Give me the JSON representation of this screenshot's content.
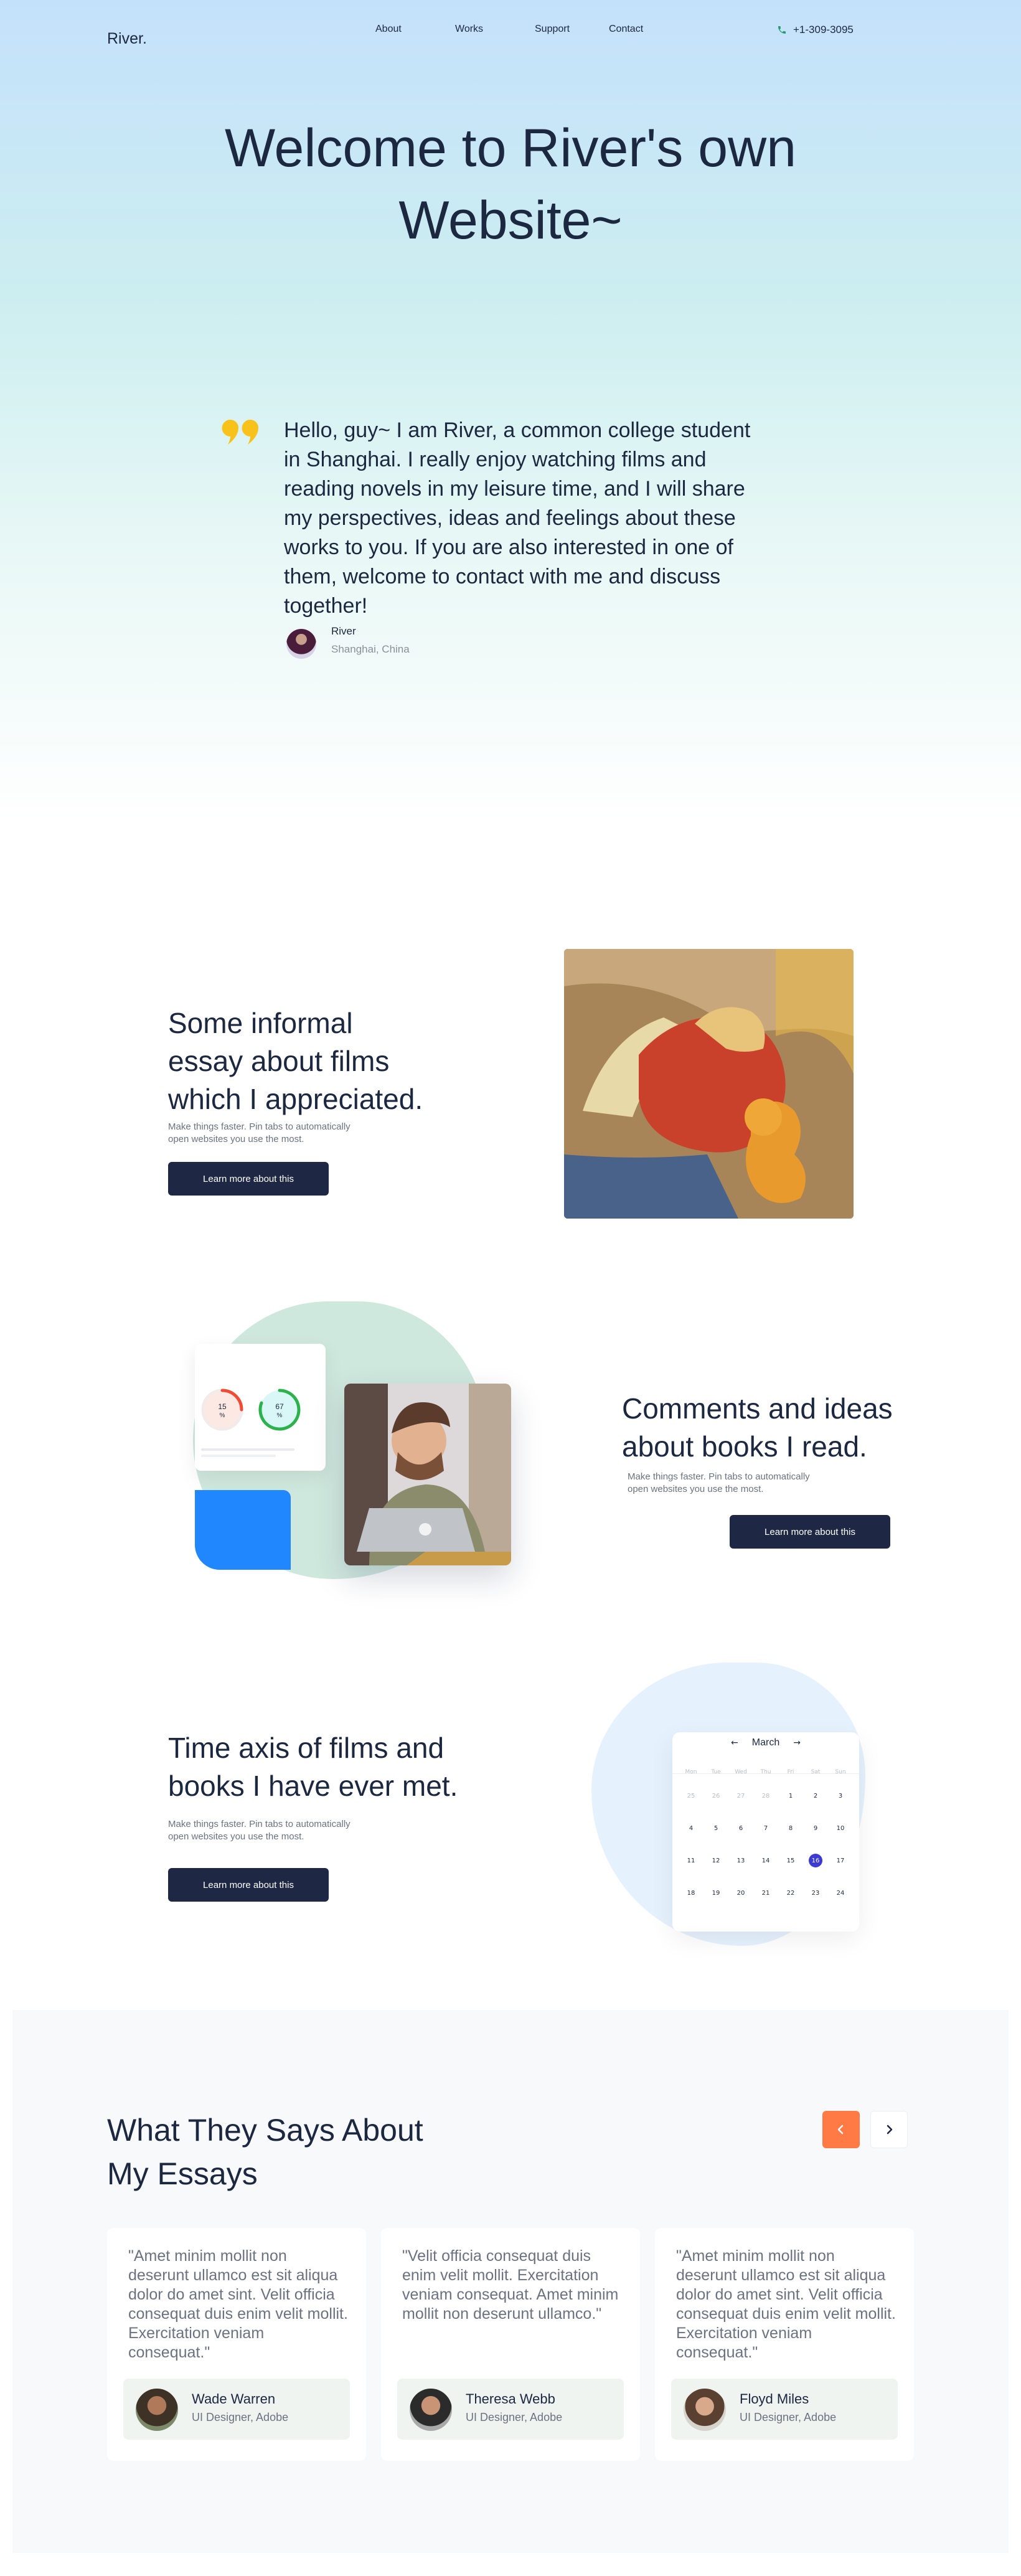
{
  "brand": "River.",
  "nav": {
    "about": "About",
    "works": "Works",
    "support": "Support",
    "contact": "Contact"
  },
  "phone": "+1-309-3095",
  "hero": {
    "title_line1": "Welcome to River's own",
    "title_line2": "Website~",
    "quote": "Hello, guy~ I am River, a common college student in Shanghai. I really enjoy watching films and reading novels in my leisure time, and I will share my perspectives, ideas and feelings about these works to you. If you are also interested in one of them, welcome to contact with me and discuss together!",
    "author_name": "River",
    "author_location": "Shanghai, China"
  },
  "features": [
    {
      "title_line1": "Some informal",
      "title_line2": "essay about films",
      "title_line3": "which I appreciated.",
      "desc_line1": "Make things faster. Pin tabs to automatically",
      "desc_line2": "open websites you use the most.",
      "button": "Learn more about this"
    },
    {
      "title_line1": "Comments and ideas",
      "title_line2": "about books I read.",
      "desc_line1": "Make things faster. Pin tabs to automatically",
      "desc_line2": "open websites you use the most.",
      "button": "Learn more about this"
    },
    {
      "title_line1": "Time axis of films and",
      "title_line2": "books I have ever met.",
      "desc_line1": "Make things faster. Pin tabs to automatically",
      "desc_line2": "open websites you use the most.",
      "button": "Learn more about this"
    }
  ],
  "ring_card": {
    "value1": "15",
    "value2": "67",
    "unit": "%"
  },
  "calendar": {
    "month": "March",
    "weekdays": [
      "Mon",
      "Tue",
      "Wed",
      "Thu",
      "Fri",
      "Sat",
      "Sun"
    ],
    "days": [
      "25",
      "26",
      "27",
      "28",
      "1",
      "2",
      "3",
      "4",
      "5",
      "6",
      "7",
      "8",
      "9",
      "10",
      "11",
      "12",
      "13",
      "14",
      "15",
      "16",
      "17",
      "18",
      "19",
      "20",
      "21",
      "22",
      "23",
      "24"
    ],
    "selected": "16"
  },
  "testimonials": {
    "title_line1": "What They Says About",
    "title_line2": "My Essays",
    "prev_icon": "chevron-left-icon",
    "next_icon": "chevron-right-icon",
    "accent": "#ff7a45",
    "items": [
      {
        "quote": "\"Amet minim mollit non deserunt ullamco est sit aliqua dolor do amet sint. Velit officia consequat duis enim velit mollit. Exercitation veniam consequat.\"",
        "name": "Wade Warren",
        "role": "UI Designer, Adobe"
      },
      {
        "quote": "\"Velit officia consequat duis enim velit mollit. Exercitation veniam consequat. Amet minim mollit non deserunt ullamco.\"",
        "name": "Theresa Webb",
        "role": "UI Designer, Adobe"
      },
      {
        "quote": "\"Amet minim mollit non deserunt ullamco est sit aliqua dolor do amet sint. Velit officia consequat duis enim velit mollit. Exercitation veniam consequat.\"",
        "name": "Floyd Miles",
        "role": "UI Designer, Adobe"
      }
    ]
  }
}
